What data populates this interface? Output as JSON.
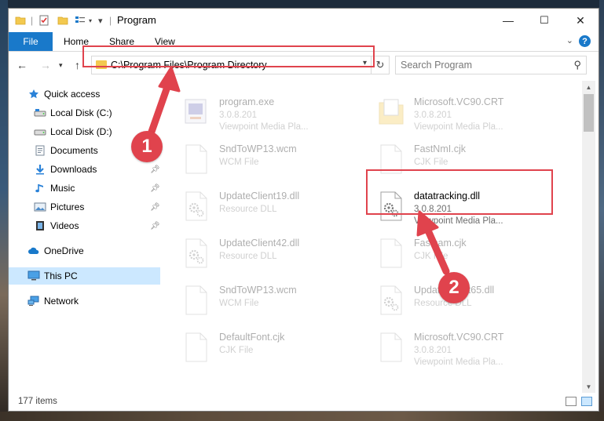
{
  "window": {
    "title": "Program",
    "controls": {
      "minimize": "—",
      "maximize": "☐",
      "close": "✕"
    }
  },
  "ribbon": {
    "tabs": [
      "File",
      "Home",
      "Share",
      "View"
    ],
    "help": "?"
  },
  "address": {
    "path": "C:\\Program Files\\Program Directory",
    "search_placeholder": "Search Program"
  },
  "sidebar": {
    "items": [
      {
        "label": "Quick access",
        "icon": "star-icon"
      },
      {
        "label": "Local Disk (C:)",
        "icon": "drive-icon"
      },
      {
        "label": "Local Disk (D:)",
        "icon": "drive-icon"
      },
      {
        "label": "Documents",
        "icon": "documents-icon"
      },
      {
        "label": "Downloads",
        "icon": "download-icon",
        "pinned": true
      },
      {
        "label": "Music",
        "icon": "music-icon",
        "pinned": true
      },
      {
        "label": "Pictures",
        "icon": "pictures-icon",
        "pinned": true
      },
      {
        "label": "Videos",
        "icon": "videos-icon",
        "pinned": true
      },
      {
        "label": "OneDrive",
        "icon": "cloud-icon"
      },
      {
        "label": "This PC",
        "icon": "computer-icon",
        "selected": true
      },
      {
        "label": "Network",
        "icon": "network-icon"
      }
    ]
  },
  "files": [
    {
      "name": "program.exe",
      "line2": "3.0.8.201",
      "line3": "Viewpoint Media Pla...",
      "icon": "exe-icon",
      "faded": true
    },
    {
      "name": "Microsoft.VC90.CRT",
      "line2": "3.0.8.201",
      "line3": "Viewpoint Media Pla...",
      "icon": "folder-doc-icon",
      "faded": true
    },
    {
      "name": "SndToWP13.wcm",
      "line2": "WCM File",
      "line3": "",
      "icon": "blank-file-icon",
      "faded": true
    },
    {
      "name": "FastNmI.cjk",
      "line2": "CJK File",
      "line3": "",
      "icon": "blank-file-icon",
      "faded": true
    },
    {
      "name": "UpdateClient19.dll",
      "line2": "Resource DLL",
      "line3": "",
      "icon": "dll-file-icon",
      "faded": true
    },
    {
      "name": "datatracking.dll",
      "line2": "3.0.8.201",
      "line3": "Viewpoint Media Pla...",
      "icon": "dll-file-icon",
      "faded": false
    },
    {
      "name": "UpdateClient42.dll",
      "line2": "Resource DLL",
      "line3": "",
      "icon": "dll-file-icon",
      "faded": true
    },
    {
      "name": "Fastcam.cjk",
      "line2": "CJK File",
      "line3": "",
      "icon": "blank-file-icon",
      "faded": true
    },
    {
      "name": "SndToWP13.wcm",
      "line2": "WCM File",
      "line3": "",
      "icon": "blank-file-icon",
      "faded": true
    },
    {
      "name": "UpdateClient65.dll",
      "line2": "Resource DLL",
      "line3": "",
      "icon": "dll-file-icon",
      "faded": true
    },
    {
      "name": "DefaultFont.cjk",
      "line2": "CJK File",
      "line3": "",
      "icon": "blank-file-icon",
      "faded": true
    },
    {
      "name": "Microsoft.VC90.CRT",
      "line2": "3.0.8.201",
      "line3": "Viewpoint Media Pla...",
      "icon": "blank-file-icon",
      "faded": true
    }
  ],
  "status": {
    "count": "177 items"
  },
  "steps": [
    "1",
    "2"
  ],
  "colors": {
    "accent": "#1979ca",
    "highlight": "#e0434d",
    "selected": "#cce8ff"
  }
}
